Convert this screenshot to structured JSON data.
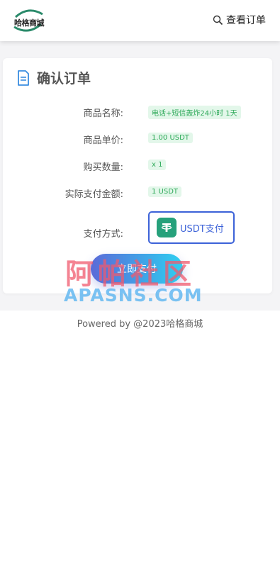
{
  "header": {
    "logo_text": "哈格商城",
    "view_orders_label": "查看订单"
  },
  "card": {
    "title": "确认订单",
    "rows": [
      {
        "label": "商品名称:",
        "value": "电话+短信轰炸24小时 1天"
      },
      {
        "label": "商品单价:",
        "value": "1.00 USDT"
      },
      {
        "label": "购买数量:",
        "value": "x 1"
      },
      {
        "label": "实际支付金额:",
        "value": "1 USDT"
      }
    ],
    "pay_method_label_title": "支付方式:",
    "pay_method": "USDT支付",
    "pay_button": "立即支付"
  },
  "footer": "Powered by @2023哈格商城",
  "watermark": {
    "cn": "阿帕社区",
    "en": "APASNS.COM"
  },
  "colors": {
    "accent": "#3c62d8",
    "tag_bg": "#e3f7ea",
    "tag_text": "#2faa5a",
    "tether": "#26a17b"
  }
}
